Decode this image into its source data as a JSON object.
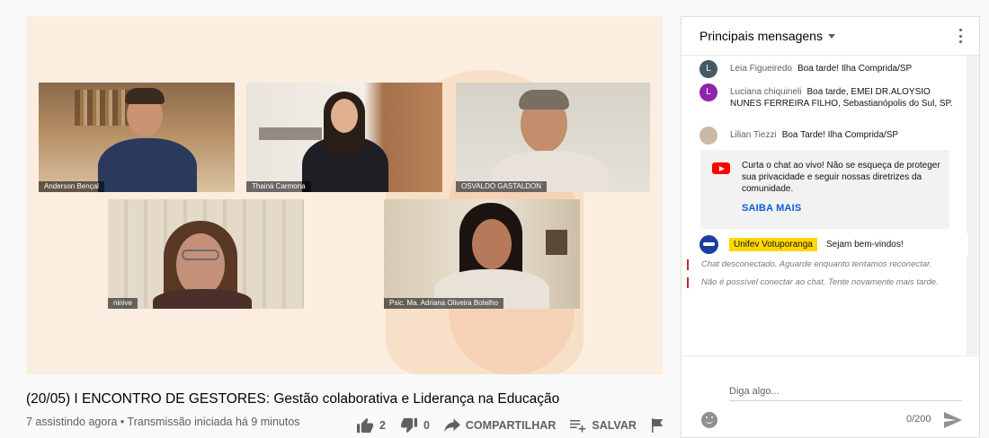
{
  "video": {
    "title": "(20/05) I ENCONTRO DE GESTORES: Gestão colaborativa e Liderança na Educação",
    "meta": "7 assistindo agora • Transmissão iniciada há 9 minutos",
    "participants": [
      {
        "name": "Anderson Bençal"
      },
      {
        "name": "Thainá Carmona"
      },
      {
        "name": "OSVALDO GASTALDON"
      },
      {
        "name": "ninive"
      },
      {
        "name": "Psic. Ma. Adriana Oliveira Botelho"
      }
    ]
  },
  "actions": {
    "likes": "2",
    "dislikes": "0",
    "share_label": "COMPARTILHAR",
    "save_label": "SALVAR"
  },
  "chat": {
    "header_title": "Principais mensagens",
    "messages": [
      {
        "initial": "L",
        "author": "Leia Figueiredo",
        "text": "Boa tarde! Ilha Comprida/SP",
        "avatar_color": "#455a64"
      },
      {
        "initial": "L",
        "author": "Luciana chiquineli",
        "text": "Boa tarde, EMEI DR.ALOYSIO NUNES FERREIRA FILHO, Sebastianópolis do Sul, SP.",
        "avatar_color": "#8e24aa"
      },
      {
        "initial": "",
        "author": "Lilian Tiezzi",
        "text": "Boa Tarde! Ilha Comprida/SP",
        "avatar_color": "#c9b9a6"
      }
    ],
    "notice": {
      "text": "Curta o chat ao vivo! Não se esqueça de proteger sua privacidade e seguir nossas diretrizes da comunidade.",
      "link": "SAIBA MAIS"
    },
    "owner_message": {
      "author": "Unifev Votuporanga",
      "text": "Sejam bem-vindos!"
    },
    "system_messages": [
      "Chat desconectado. Aguarde enquanto tentamos reconectar.",
      "Não é possível conectar ao chat. Tente novamente mais tarde."
    ],
    "input_placeholder": "Diga algo...",
    "counter": "0/200"
  },
  "colors": {
    "accent_link": "#065fd4",
    "owner_badge": "#ffd600",
    "youtube_red": "#ff0000",
    "error_bar": "#c62828"
  }
}
